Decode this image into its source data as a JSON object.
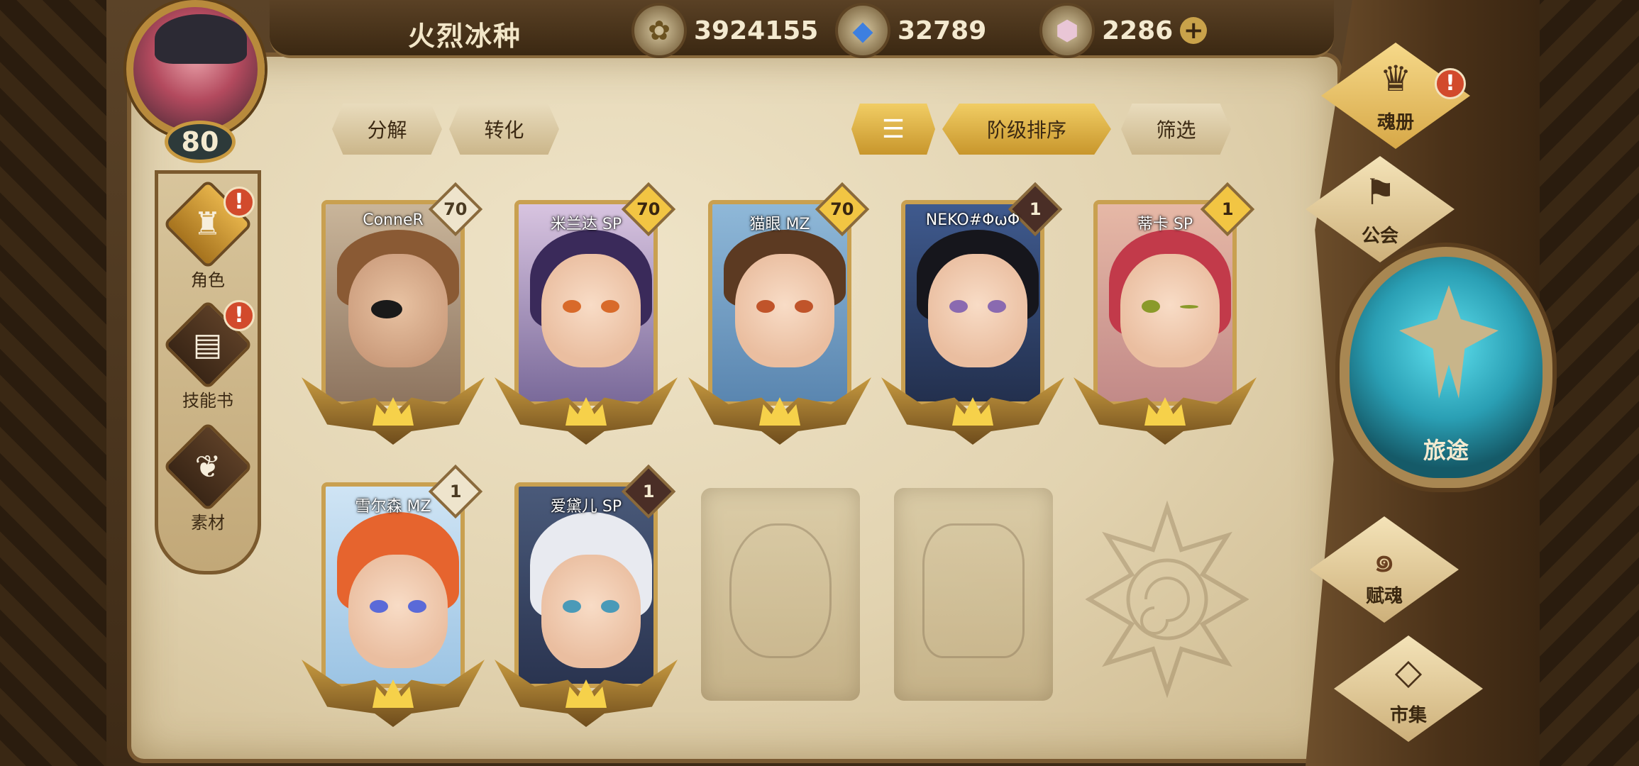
{
  "header": {
    "player_name": "火烈冰种",
    "gold": "3924155",
    "crystal": "32789",
    "gem": "2286",
    "level": "80"
  },
  "left_nav": [
    {
      "label": "角色",
      "icon": "helmet-icon",
      "alert": "!"
    },
    {
      "label": "技能书",
      "icon": "book-icon",
      "alert": "!"
    },
    {
      "label": "素材",
      "icon": "material-icon"
    }
  ],
  "tabs": {
    "decompose": "分解",
    "convert": "转化",
    "sort_by_tier": "阶级排序",
    "filter": "筛选"
  },
  "cards": [
    {
      "name": "ConneR",
      "level": "70",
      "badge": "light"
    },
    {
      "name": "米兰达 SP",
      "level": "70",
      "badge": "gold"
    },
    {
      "name": "猫眼 MZ",
      "level": "70",
      "badge": "gold"
    },
    {
      "name": "NEKO#ΦωΦ",
      "level": "1",
      "badge": "dark"
    },
    {
      "name": "蒂卡 SP",
      "level": "1",
      "badge": "gold"
    },
    {
      "name": "雪尔森 MZ",
      "level": "1",
      "badge": "light"
    },
    {
      "name": "爱黛儿 SP",
      "level": "1",
      "badge": "dark"
    }
  ],
  "right_nav": {
    "soul_book": "魂册",
    "soul_book_alert": "!",
    "guild": "公会",
    "journey": "旅途",
    "endow_soul": "赋魂",
    "market": "市集"
  },
  "colors": {
    "gold_accent": "#f2c543",
    "alert_red": "#d24a2c",
    "parchment": "#e2d3b0",
    "journey_teal": "#2a9fb4"
  }
}
